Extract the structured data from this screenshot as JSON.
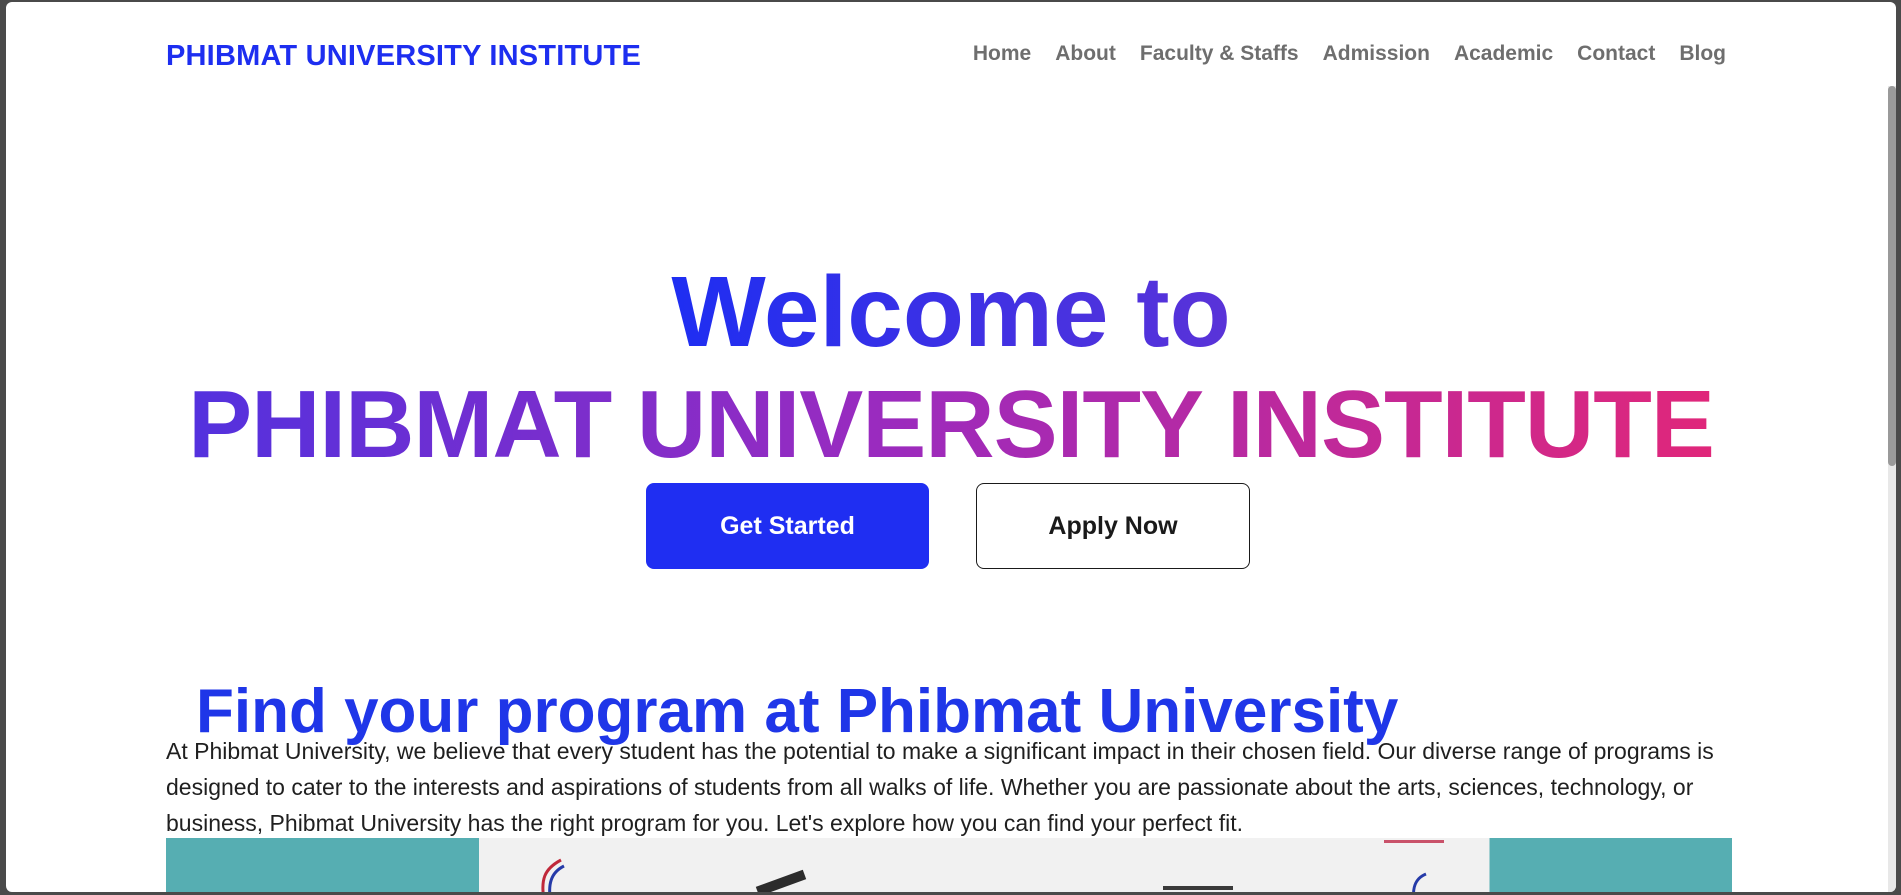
{
  "navbar": {
    "brand": "PHIBMAT UNIVERSITY INSTITUTE",
    "links": [
      "Home",
      "About",
      "Faculty & Staffs",
      "Admission",
      "Academic",
      "Contact",
      "Blog"
    ]
  },
  "hero": {
    "line1": "Welcome to",
    "line2": "PHIBMAT UNIVERSITY INSTITUTE",
    "primary_button": "Get Started",
    "secondary_button": "Apply Now"
  },
  "programs": {
    "title": "Find your program at Phibmat University",
    "description": "At Phibmat University, we believe that every student has the potential to make a significant impact in their chosen field. Our diverse range of programs is designed to cater to the interests and aspirations of students from all walks of life. Whether you are passionate about the arts, sciences, technology, or business, Phibmat University has the right program for you. Let's explore how you can find your perfect fit."
  },
  "colors": {
    "accent": "#1f2ef2",
    "gradient_end": "#e0277a",
    "nav_text": "#6e6e6e"
  }
}
